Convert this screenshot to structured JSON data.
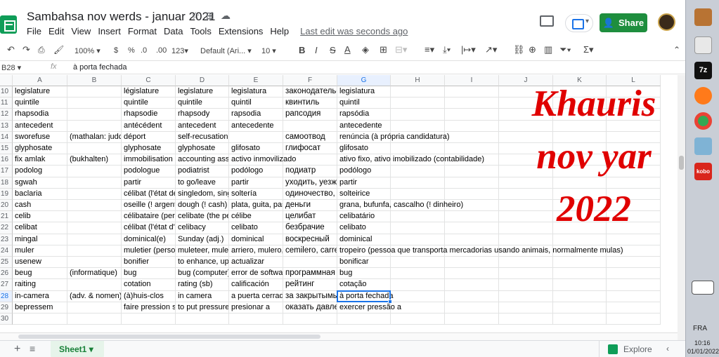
{
  "app": {
    "title": "Sambahsa nov werds - januar 2021",
    "menu": [
      "File",
      "Edit",
      "View",
      "Insert",
      "Format",
      "Data",
      "Tools",
      "Extensions",
      "Help"
    ],
    "last_edit": "Last edit was seconds ago",
    "share_label": "Share"
  },
  "toolbar": {
    "zoom": "100%",
    "currency": "$",
    "percent": "%",
    "dec_minus": ".0",
    "dec_plus": ".00",
    "more_formats": "123",
    "font": "Default (Ari...",
    "font_size": "10",
    "bold": "B",
    "italic": "I",
    "strike": "S",
    "text_color": "A"
  },
  "formula_bar": {
    "cell_ref": "B28",
    "fx": "fx",
    "value": "à porta fechada"
  },
  "columns": [
    "A",
    "B",
    "C",
    "D",
    "E",
    "F",
    "G",
    "H",
    "I",
    "J",
    "K",
    "L"
  ],
  "selected_col": "G",
  "selected_row": "28",
  "rows": [
    {
      "n": "10",
      "cells": [
        "legislature",
        "",
        "législature",
        "legislature",
        "legislatura",
        "законодательст",
        "legislatura"
      ]
    },
    {
      "n": "11",
      "cells": [
        "quintile",
        "",
        "quintile",
        "quintile",
        "quintil",
        "квинтиль",
        "quintil"
      ]
    },
    {
      "n": "12",
      "cells": [
        "rhapsodia",
        "",
        "rhapsodie",
        "rhapsody",
        "rapsodia",
        "рапсодия",
        "rapsódia"
      ]
    },
    {
      "n": "13",
      "cells": [
        "antecedent",
        "",
        "antécédent",
        "antecedent",
        "antecedente",
        "",
        "antecedente"
      ]
    },
    {
      "n": "14",
      "cells": [
        "sworefuse",
        "(mathalan: judce",
        "déport",
        "self-recusation",
        "",
        "самоотвод",
        "renúncia (à própria candidatura)"
      ]
    },
    {
      "n": "15",
      "cells": [
        "glyphosate",
        "",
        "glyphosate",
        "glyphosate",
        "glifosato",
        "глифосат",
        "glifosato"
      ]
    },
    {
      "n": "16",
      "cells": [
        "fix amlak",
        "(bukhalten)",
        "immobilisation co",
        "accounting asse",
        "activo inmovilizado",
        "",
        "ativo fixo, ativo imobilizado (contabilidade)"
      ]
    },
    {
      "n": "17",
      "cells": [
        "podolog",
        "",
        "podologue",
        "podiatrist",
        "podólogo",
        "подиатр",
        "podólogo"
      ]
    },
    {
      "n": "18",
      "cells": [
        "sgwah",
        "",
        "partir",
        "to go/leave",
        "partir",
        "уходить, уезжа",
        "partir"
      ]
    },
    {
      "n": "19",
      "cells": [
        "baclaria",
        "",
        "célibat (l'état de",
        "singledom, singl",
        "soltería",
        "одиночество, сс",
        "solteirice"
      ]
    },
    {
      "n": "20",
      "cells": [
        "cash",
        "",
        "oseille (! argent)",
        "dough (! cash)",
        "plata, guita, past",
        "деньги",
        "grana, bufunfa, cascalho (! dinheiro)"
      ]
    },
    {
      "n": "21",
      "cells": [
        "celib",
        "",
        "célibataire (pers",
        "celibate (the per",
        "célibe",
        "целибат",
        "celibatário"
      ]
    },
    {
      "n": "22",
      "cells": [
        "celibat",
        "",
        "célibat (l'état d'u",
        "celibacy",
        "celibato",
        "безбрачие",
        "celibato"
      ]
    },
    {
      "n": "23",
      "cells": [
        "mingal",
        "",
        "dominical(e)",
        "Sunday (adj.)",
        "dominical",
        "воскресный",
        "dominical"
      ]
    },
    {
      "n": "24",
      "cells": [
        "muler",
        "",
        "muletier (person",
        "muleteer, mulest",
        "arriero, mulero, a",
        "cemilero, carrete",
        "tropeiro (pessoa que transporta mercadorias usando animais, normalmente mulas)"
      ]
    },
    {
      "n": "25",
      "cells": [
        "usenew",
        "",
        "bonifier",
        "to enhance, upg",
        "actualizar",
        "",
        "bonificar"
      ]
    },
    {
      "n": "26",
      "cells": [
        "beug",
        "(informatique)",
        "bug",
        "bug (computer)",
        "error de software",
        "программная с",
        "bug"
      ]
    },
    {
      "n": "27",
      "cells": [
        "raiting",
        "",
        "cotation",
        "rating (sb)",
        "calificación",
        "рейтинг",
        "cotação"
      ]
    },
    {
      "n": "28",
      "cells": [
        "in-camera",
        "(adv. & nomen)",
        "(à)huis-clos",
        "in camera",
        "a puerta cerrada",
        "за закрытымы",
        "à porta fechada"
      ]
    },
    {
      "n": "29",
      "cells": [
        "bepressem",
        "",
        "faire pression su",
        "to put pressure c",
        "presionar a",
        "оказать давле",
        "exercer pressão a"
      ]
    },
    {
      "n": "30",
      "cells": [
        "",
        "",
        "",
        "",
        "",
        "",
        ""
      ]
    }
  ],
  "overlay": {
    "line1": "Khauris",
    "line2": "nov yar",
    "line3": "2022",
    "color": "#e00000"
  },
  "sheets": {
    "active": "Sheet1",
    "explore": "Explore"
  },
  "taskbar": {
    "lang": "FRA",
    "time": "10:16",
    "date": "01/01/2022",
    "icons": [
      "book-icon",
      "scissors-icon",
      "7zip-icon",
      "firefox-icon",
      "chrome-icon",
      "notebook-icon",
      "kobo-icon",
      "keyboard-icon"
    ]
  }
}
